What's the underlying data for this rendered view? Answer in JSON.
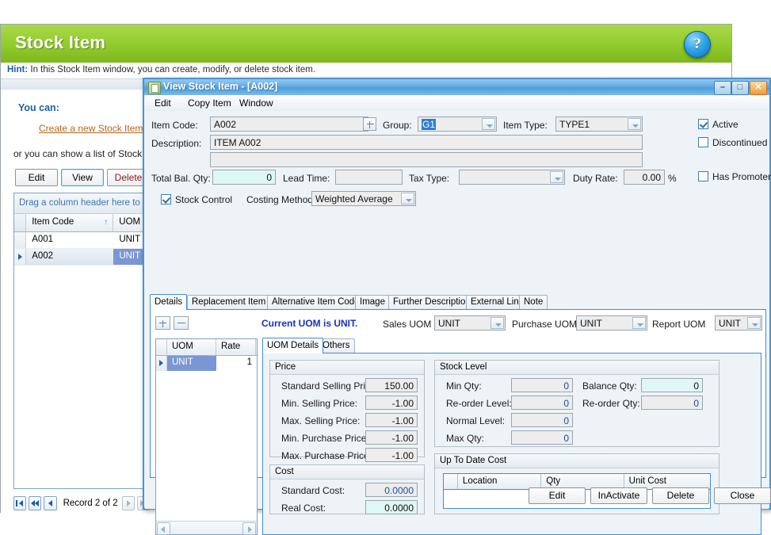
{
  "background": {
    "header_title": "Stock Item",
    "help_icon": "help-question-icon",
    "hint_label": "Hint:",
    "hint_text": "In this Stock Item window, you can create, modify, or delete stock item.",
    "you_can_label": "You can:",
    "create_link": "Create a new Stock Item",
    "or_line": "or you can show a list of Stock I",
    "buttons": {
      "edit": "Edit",
      "view": "View",
      "delete": "Delete"
    },
    "grid": {
      "drag_hint": "Drag a column header here to gr",
      "columns": [
        "Item Code",
        "UOM"
      ],
      "sort_indicator": "↑",
      "rows": [
        {
          "item_code": "A001",
          "uom": "UNIT",
          "selected": false
        },
        {
          "item_code": "A002",
          "uom": "UNIT",
          "selected": true
        }
      ]
    },
    "record_nav": {
      "first": "first-record-icon",
      "prev_page": "prev-page-icon",
      "prev": "prev-record-icon",
      "text": "Record 2 of 2",
      "next": "next-record-icon",
      "last": "last-record-icon"
    }
  },
  "window": {
    "title": "View Stock Item - [A002]",
    "icon": "stock-item-window-icon",
    "controls": {
      "minimize": "–",
      "maximize": "□",
      "close": "✕"
    },
    "menu": [
      "Edit",
      "Copy Item",
      "Window"
    ],
    "header_fields": {
      "item_code_label": "Item Code:",
      "item_code_value": "A002",
      "item_code_lookup": "lookup-plus-icon",
      "group_label": "Group:",
      "group_value": "G1",
      "item_type_label": "Item Type:",
      "item_type_value": "TYPE1",
      "description_label": "Description:",
      "description_value": "ITEM A002",
      "description_value2": "",
      "total_bal_qty_label": "Total Bal. Qty:",
      "total_bal_qty_value": "0",
      "lead_time_label": "Lead Time:",
      "lead_time_value": "",
      "tax_type_label": "Tax Type:",
      "tax_type_value": "",
      "duty_rate_label": "Duty Rate:",
      "duty_rate_value": "0.00",
      "duty_rate_unit": "%",
      "active_label": "Active",
      "active_checked": true,
      "discontinued_label": "Discontinued",
      "discontinued_checked": false,
      "has_promoter_label": "Has Promoter",
      "has_promoter_checked": false,
      "stock_control_label": "Stock Control",
      "stock_control_checked": true,
      "costing_method_label": "Costing Method:",
      "costing_method_value": "Weighted Average"
    },
    "tabs": [
      {
        "label": "Details",
        "active": true
      },
      {
        "label": "Replacement Item",
        "active": false
      },
      {
        "label": "Alternative Item Code",
        "active": false
      },
      {
        "label": "Image",
        "active": false
      },
      {
        "label": "Further Description",
        "active": false
      },
      {
        "label": "External Link",
        "active": false
      },
      {
        "label": "Note",
        "active": false
      }
    ],
    "details": {
      "add_button": "add-uom-icon",
      "remove_button": "remove-uom-icon",
      "current_uom_text": "Current UOM is UNIT.",
      "sales_uom_label": "Sales UOM",
      "sales_uom_value": "UNIT",
      "purchase_uom_label": "Purchase UOM",
      "purchase_uom_value": "UNIT",
      "report_uom_label": "Report UOM",
      "report_uom_value": "UNIT",
      "uom_grid": {
        "columns": [
          "UOM",
          "Rate"
        ],
        "rows": [
          {
            "uom": "UNIT",
            "rate": "1",
            "selected": true
          }
        ]
      },
      "inner_tabs": [
        {
          "label": "UOM Details",
          "active": true
        },
        {
          "label": "Others",
          "active": false
        }
      ],
      "price_group": {
        "caption": "Price",
        "rows": [
          {
            "label": "Standard Selling Price:",
            "value": "150.00"
          },
          {
            "label": "Min. Selling Price:",
            "value": "-1.00"
          },
          {
            "label": "Max. Selling Price:",
            "value": "-1.00"
          },
          {
            "label": "Min. Purchase Price:",
            "value": "-1.00"
          },
          {
            "label": "Max. Purchase Price:",
            "value": "-1.00"
          }
        ]
      },
      "cost_group": {
        "caption": "Cost",
        "rows": [
          {
            "label": "Standard Cost:",
            "value": "0.0000",
            "blue": true,
            "cyan": false
          },
          {
            "label": "Real Cost:",
            "value": "0.0000",
            "blue": false,
            "cyan": true
          }
        ]
      },
      "stock_level_group": {
        "caption": "Stock Level",
        "left_rows": [
          {
            "label": "Min Qty:",
            "value": "0"
          },
          {
            "label": "Re-order Level:",
            "value": "0"
          },
          {
            "label": "Normal Level:",
            "value": "0"
          },
          {
            "label": "Max Qty:",
            "value": "0"
          }
        ],
        "right_rows": [
          {
            "label": "Balance Qty:",
            "value": "0",
            "cyan": true
          },
          {
            "label": "Re-order Qty:",
            "value": "0",
            "cyan": false
          }
        ]
      },
      "up_to_date_cost": {
        "caption": "Up To Date Cost",
        "columns": [
          "Location",
          "Qty",
          "Unit Cost"
        ],
        "rows": []
      }
    },
    "footer_buttons": [
      "Edit",
      "InActivate",
      "Delete",
      "Close"
    ]
  },
  "colors": {
    "header_green": "#93cc2e",
    "title_blue": "#4f9ddb",
    "link_orange": "#b5651d",
    "hint_blue": "#1a5fa8",
    "selection_blue": "#7b96d4",
    "cyan_field": "#dff7f5"
  }
}
